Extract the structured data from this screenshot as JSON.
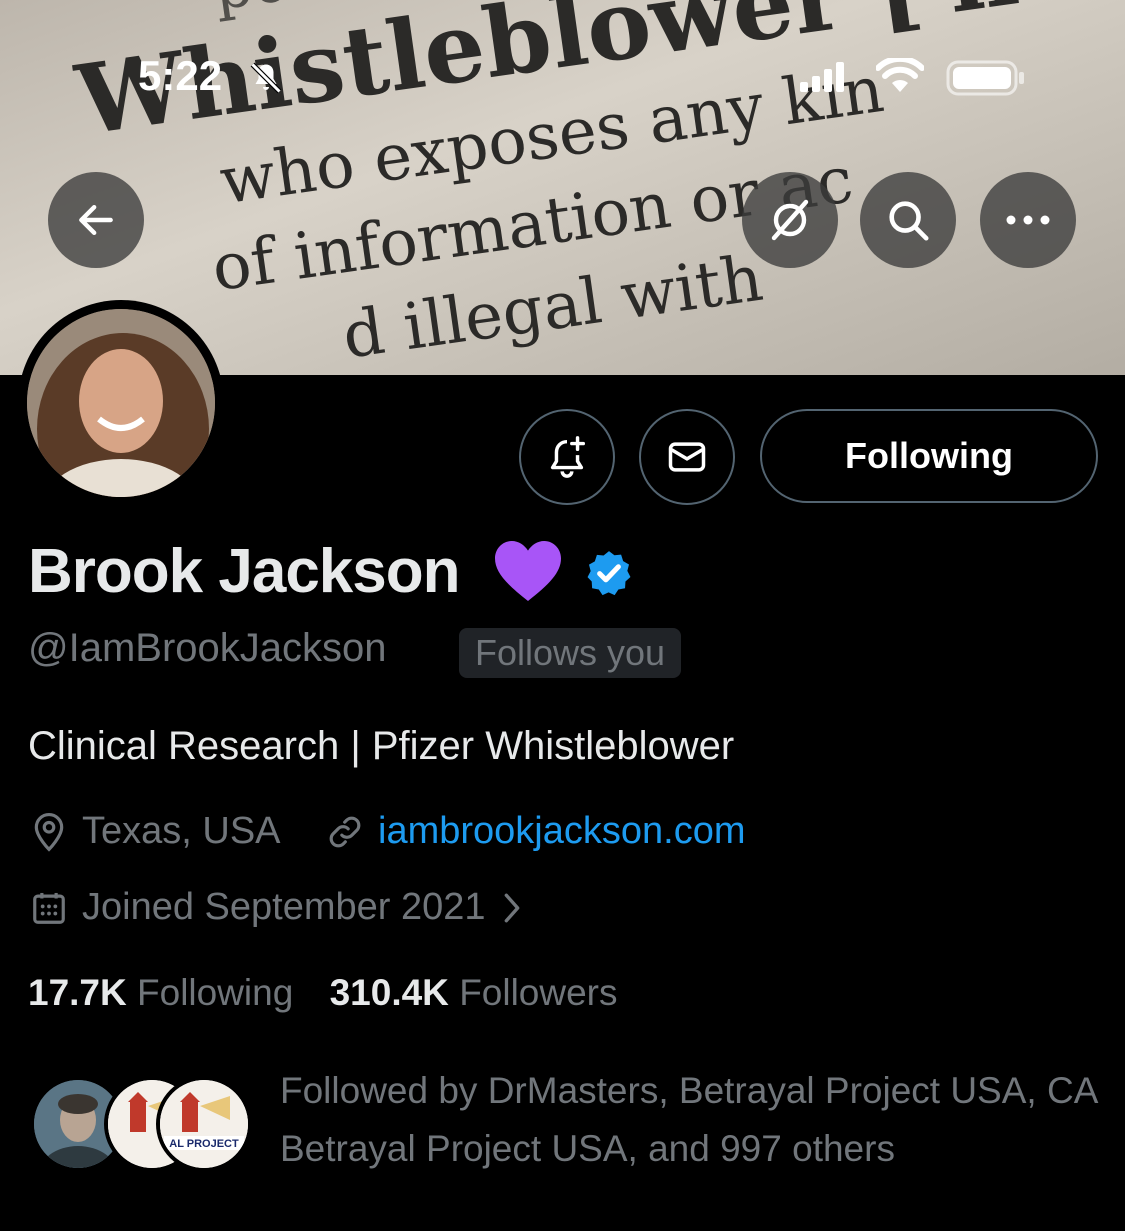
{
  "status_bar": {
    "time": "5:22"
  },
  "banner": {
    "lines": [
      "point of vi",
      "Whistleblower [ˈh",
      "who exposes any kin",
      "of information or ac",
      "d illegal with"
    ]
  },
  "profile": {
    "name": "Brook Jackson",
    "handle": "@IamBrookJackson",
    "follows_you": "Follows you",
    "bio": "Clinical Research | Pfizer Whistleblower",
    "location": "Texas, USA",
    "website": "iambrookjackson.com",
    "joined": "Joined September 2021",
    "following_count": "17.7K",
    "following_label": "Following",
    "followers_count": "310.4K",
    "followers_label": "Followers",
    "followed_by": "Followed by DrMasters, Betrayal Project USA, CA Betrayal Project USA, and 997 others",
    "mini_avatar_text": "AL PROJECT"
  },
  "actions": {
    "following_button": "Following"
  },
  "colors": {
    "accent": "#1d9bf0",
    "muted": "#71767b",
    "heart": "#a855f7"
  }
}
